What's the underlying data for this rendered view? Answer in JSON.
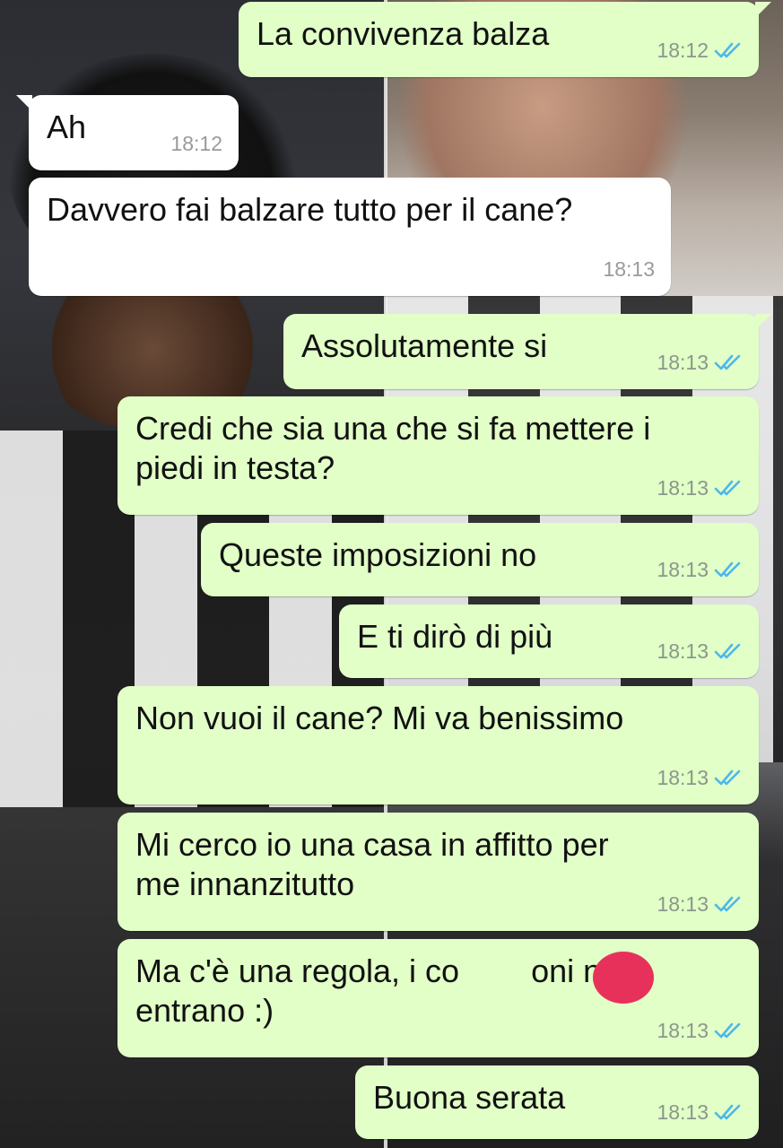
{
  "chat": {
    "messages": [
      {
        "text": "La convivenza balza",
        "time": "18:12",
        "direction": "outgoing",
        "status": "read"
      },
      {
        "text": "Ah",
        "time": "18:12",
        "direction": "incoming"
      },
      {
        "text": "Davvero fai balzare tutto per il cane?",
        "time": "18:13",
        "direction": "incoming"
      },
      {
        "text": "Assolutamente si",
        "time": "18:13",
        "direction": "outgoing",
        "status": "read"
      },
      {
        "text": "Credi che sia una che si fa mettere i\npiedi in testa?",
        "time": "18:13",
        "direction": "outgoing",
        "status": "read"
      },
      {
        "text": "Queste imposizioni no",
        "time": "18:13",
        "direction": "outgoing",
        "status": "read"
      },
      {
        "text": "E ti dirò di più",
        "time": "18:13",
        "direction": "outgoing",
        "status": "read"
      },
      {
        "text": "Non vuoi il cane? Mi va benissimo",
        "time": "18:13",
        "direction": "outgoing",
        "status": "read"
      },
      {
        "text": "Mi cerco io una casa in affitto per\nme innanzitutto",
        "time": "18:13",
        "direction": "outgoing",
        "status": "read"
      },
      {
        "text": "Ma c'è una regola, i co        oni non\nentrano :)",
        "time": "18:13",
        "direction": "outgoing",
        "status": "read"
      },
      {
        "text": "Buona serata",
        "time": "18:13",
        "direction": "outgoing",
        "status": "read"
      }
    ]
  },
  "colors": {
    "outgoing_bubble": "#e1ffc7",
    "incoming_bubble": "#ffffff",
    "read_ticks": "#4fb6ec",
    "redaction": "#e8315a"
  },
  "icons": {
    "read_status": "double-check-icon"
  }
}
